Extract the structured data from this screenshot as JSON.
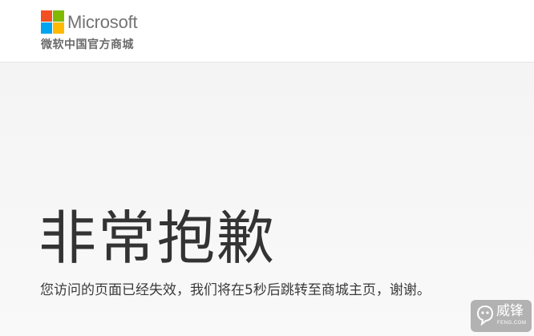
{
  "header": {
    "brand": "Microsoft",
    "store_label": "微软中国官方商城",
    "logo_colors": {
      "red": "#f25022",
      "green": "#7fba00",
      "blue": "#00a4ef",
      "yellow": "#ffb900"
    }
  },
  "main": {
    "headline": "非常抱歉",
    "message": "您访问的页面已经失效，我们将在5秒后跳转至商城主页，谢谢。"
  },
  "watermark": {
    "text": "威锋",
    "subtext": "FENG.COM",
    "icon": "feng-logo-icon"
  }
}
